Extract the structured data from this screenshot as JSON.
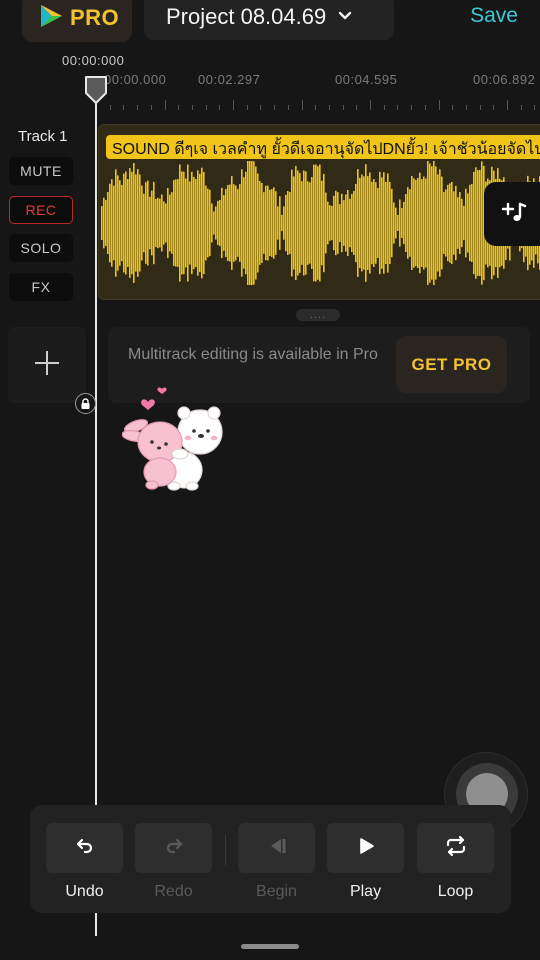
{
  "header": {
    "pro_label": "PRO",
    "project_title": "Project 08.04.69",
    "save_label": "Save"
  },
  "ruler": {
    "current_time": "00:00:000",
    "tick_labels": [
      "00:00.000",
      "00:02.297",
      "00:04.595",
      "00:06.892"
    ]
  },
  "track": {
    "name": "Track 1",
    "buttons": {
      "mute": "MUTE",
      "rec": "REC",
      "solo": "SOLO",
      "fx": "FX"
    },
    "clip_title": "SOUND ดีๆเจ เวลคําทู ยั้วดีเจอานุจัดไปDNยั้ว! เจ้าชัวน้อยจัดไป"
  },
  "resize_handle": {
    "dots": "...."
  },
  "promo": {
    "text": "Multitrack editing is available in Pro",
    "button_label": "GET PRO"
  },
  "transport": {
    "undo": "Undo",
    "redo": "Redo",
    "begin": "Begin",
    "play": "Play",
    "loop": "Loop"
  },
  "colors": {
    "accent_yellow": "#f2c230",
    "save_cyan": "#3ec9d8",
    "rec_red": "#e23b3b",
    "waveform": "#f0c419"
  },
  "icons": [
    "play-logo-icon",
    "chevron-down-icon",
    "playhead-icon",
    "add-clip-icon",
    "plus-icon",
    "lock-icon",
    "undo-icon",
    "redo-icon",
    "skip-to-begin-icon",
    "play-icon",
    "loop-icon",
    "record-icon"
  ]
}
